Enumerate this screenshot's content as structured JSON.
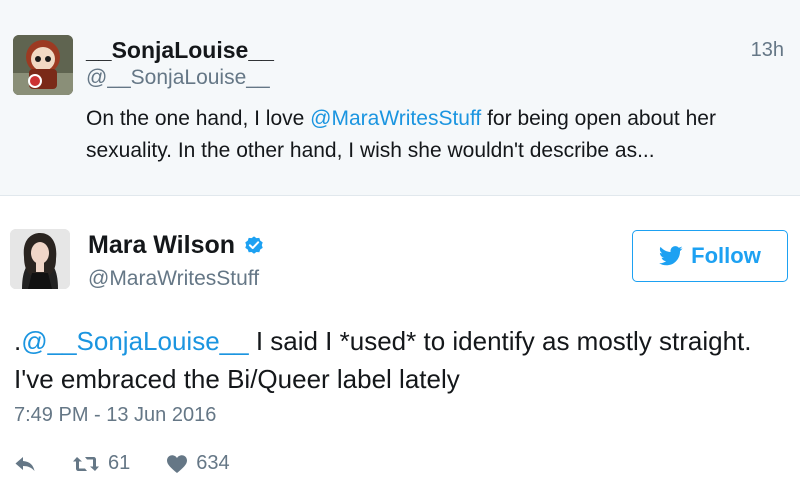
{
  "parent_tweet": {
    "display_name": "__SonjaLouise__",
    "handle": "@__SonjaLouise__",
    "time_ago": "13h",
    "text_before": "On the one hand, I love ",
    "mention": "@MaraWritesStuff",
    "text_after": " for being open about her sexuality. In the other hand, I wish she wouldn't describe as..."
  },
  "tweet": {
    "display_name": "Mara Wilson",
    "handle": "@MaraWritesStuff",
    "follow_label": "Follow",
    "text_prefix": ".",
    "mention": "@__SonjaLouise__",
    "text_after": " I said I *used* to identify as mostly straight. I've embraced the Bi/Queer label lately",
    "timestamp": "7:49 PM - 13 Jun 2016",
    "retweet_count": "61",
    "like_count": "634"
  },
  "icons": {
    "verified": "verified-badge-icon",
    "bird": "twitter-bird-icon",
    "reply": "reply-arrow-icon",
    "retweet": "retweet-icon",
    "like": "heart-icon"
  },
  "colors": {
    "accent": "#1da1f2",
    "mention": "#1b95e0",
    "muted": "#657786",
    "parent_bg": "#f5f8fa"
  }
}
